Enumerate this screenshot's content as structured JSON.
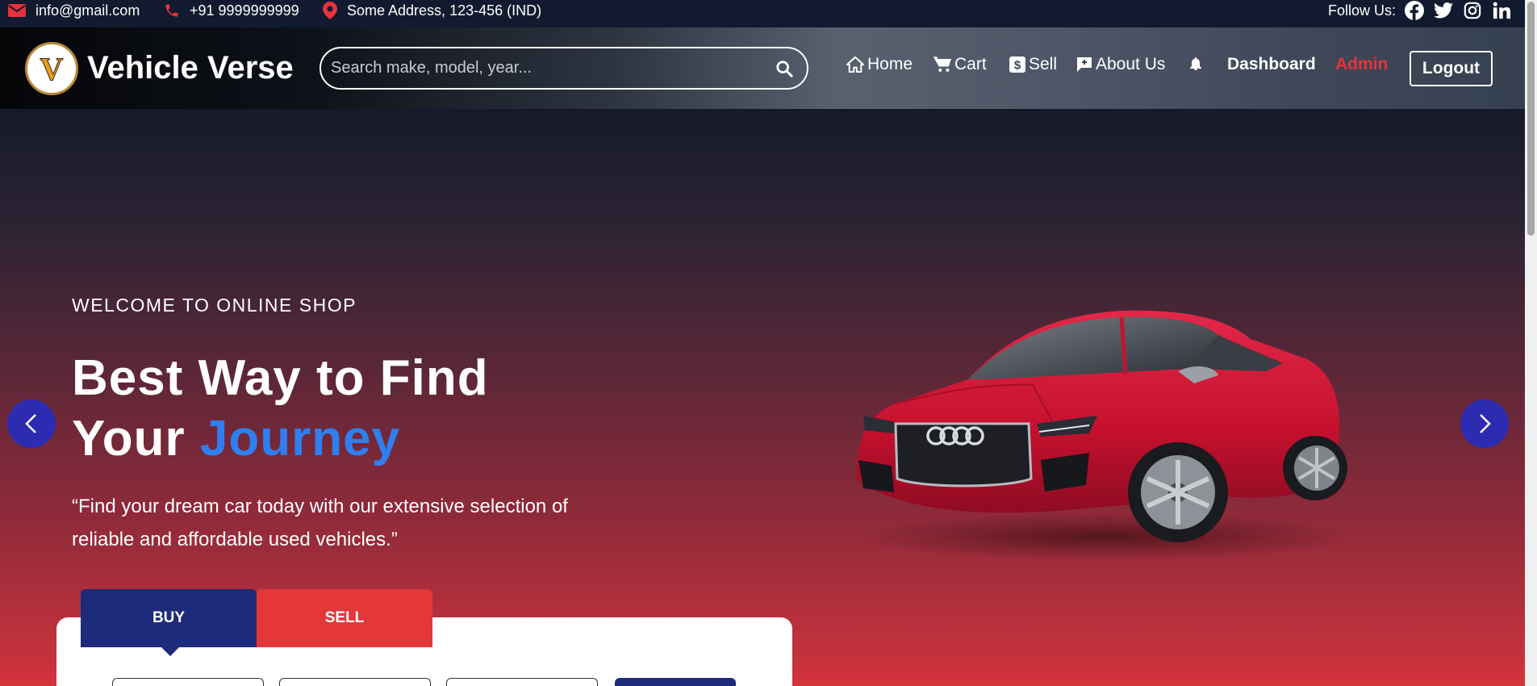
{
  "topbar": {
    "email": "info@gmail.com",
    "phone": "+91 9999999999",
    "address": "Some Address, 123-456 (IND)",
    "follow_label": "Follow Us:",
    "socials": [
      "facebook-icon",
      "twitter-icon",
      "instagram-icon",
      "linkedin-icon"
    ]
  },
  "navbar": {
    "logo_letter": "V",
    "brand": "Vehicle Verse",
    "search_placeholder": "Search make, model, year...",
    "items": {
      "home": "Home",
      "cart": "Cart",
      "sell": "Sell",
      "about": "About Us",
      "dashboard": "Dashboard",
      "admin": "Admin"
    },
    "logout": "Logout"
  },
  "hero": {
    "welcome": "WELCOME TO ONLINE SHOP",
    "headline_line1": "Best Way to Find",
    "headline_line2_a": "Your ",
    "headline_line2_b": "Journey",
    "quote": "“Find your dream car today with our extensive selection of reliable and affordable used vehicles.”"
  },
  "tabs": {
    "buy": "BUY",
    "sell": "SELL"
  },
  "colors": {
    "accent_blue": "#2f7ff0",
    "admin_red": "#e8323a",
    "buy_navy": "#1e2a7a",
    "sell_red": "#e3373a",
    "arrow_blue": "#2d2bb0",
    "car_red": "#d0183a"
  }
}
